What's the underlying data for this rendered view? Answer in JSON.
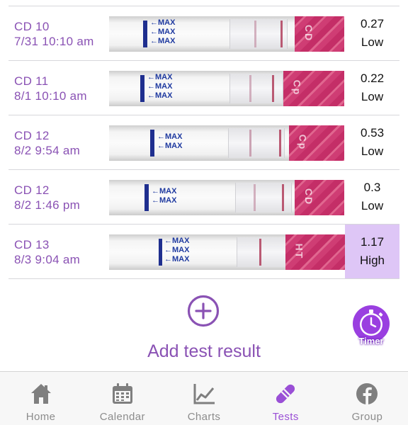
{
  "tests": [
    {
      "cycle_day": "CD 10",
      "datetime": "7/31 10:10 am",
      "value": "0.27",
      "level": "Low",
      "strip_text": "MAX"
    },
    {
      "cycle_day": "CD 11",
      "datetime": "8/1 10:10 am",
      "value": "0.22",
      "level": "Low",
      "strip_text": "MAX"
    },
    {
      "cycle_day": "CD 12",
      "datetime": "8/2 9:54 am",
      "value": "0.53",
      "level": "Low",
      "strip_text": "MAX"
    },
    {
      "cycle_day": "CD 12",
      "datetime": "8/2 1:46 pm",
      "value": "0.3",
      "level": "Low",
      "strip_text": "MAX"
    },
    {
      "cycle_day": "CD 13",
      "datetime": "8/3 9:04 am",
      "value": "1.17",
      "level": "High",
      "strip_text": "MAX"
    }
  ],
  "add_test": {
    "label": "Add test result",
    "icon": "plus-circle-icon"
  },
  "timer": {
    "label": "Timer",
    "icon": "stopwatch-icon"
  },
  "tabbar": {
    "tabs": [
      {
        "label": "Home",
        "icon": "home-icon",
        "active": false
      },
      {
        "label": "Calendar",
        "icon": "calendar-icon",
        "active": false
      },
      {
        "label": "Charts",
        "icon": "chart-icon",
        "active": false
      },
      {
        "label": "Tests",
        "icon": "test-strip-icon",
        "active": true
      },
      {
        "label": "Group",
        "icon": "facebook-icon",
        "active": false
      }
    ]
  },
  "colors": {
    "accent": "#8a52b4",
    "active_tab": "#9a4fd6",
    "inactive_tab": "#8c8c8c",
    "high_highlight": "#dec6f6",
    "divider": "#d7d7db"
  }
}
